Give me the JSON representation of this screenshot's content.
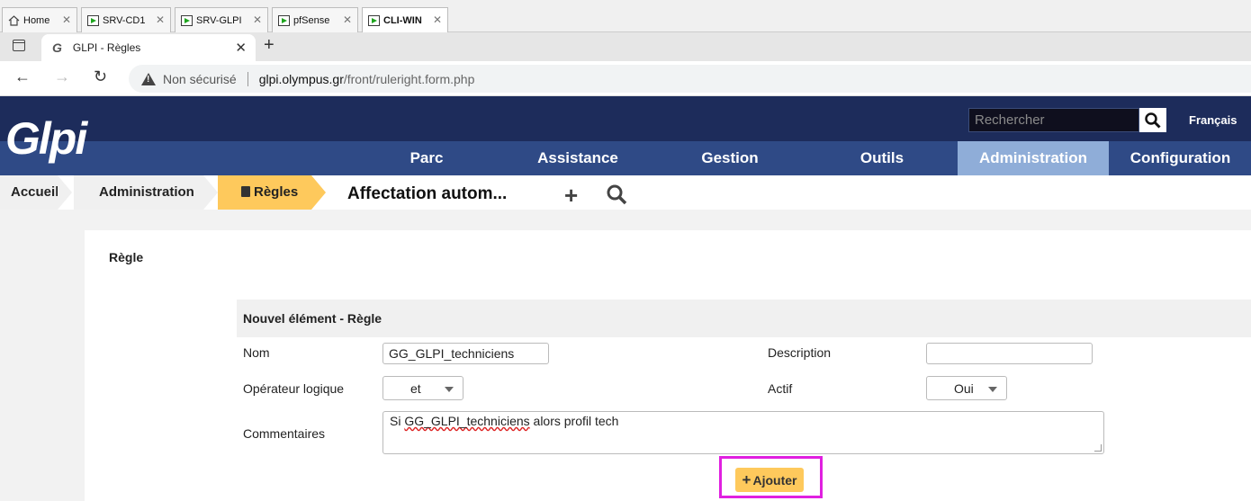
{
  "vm_tabs": [
    {
      "label": "Home",
      "icon": "home-icon"
    },
    {
      "label": "SRV-CD1",
      "icon": "vm-icon"
    },
    {
      "label": "SRV-GLPI",
      "icon": "vm-icon"
    },
    {
      "label": "pfSense",
      "icon": "vm-icon"
    },
    {
      "label": "CLI-WIN",
      "icon": "vm-icon",
      "active": true
    }
  ],
  "browser": {
    "tab_title": "GLPI - Règles",
    "security_label": "Non sécurisé",
    "url_host": "glpi.olympus.gr",
    "url_path": "/front/ruleright.form.php"
  },
  "header": {
    "logo_text": "Glpi",
    "search_placeholder": "Rechercher",
    "language": "Français",
    "menu": [
      "Parc",
      "Assistance",
      "Gestion",
      "Outils",
      "Administration",
      "Configuration"
    ],
    "active_menu": "Administration"
  },
  "breadcrumb": {
    "items": [
      "Accueil",
      "Administration",
      "Règles"
    ],
    "page_title": "Affectation autom..."
  },
  "form": {
    "section_title": "Règle",
    "header": "Nouvel élément - Règle",
    "name_label": "Nom",
    "name_value": "GG_GLPI_techniciens",
    "description_label": "Description",
    "description_value": "",
    "operator_label": "Opérateur logique",
    "operator_value": "et",
    "active_label": "Actif",
    "active_value": "Oui",
    "comments_label": "Commentaires",
    "comments_prefix": "Si ",
    "comments_misspelled": "GG_GLPI_techniciens",
    "comments_suffix": " alors profil tech",
    "submit_label": "Ajouter"
  },
  "colors": {
    "header_dark": "#1d2c5b",
    "nav_bar": "#2f4a86",
    "nav_active": "#8fadd8",
    "accent_yellow": "#fec95c",
    "highlight_box": "#e020e0"
  }
}
